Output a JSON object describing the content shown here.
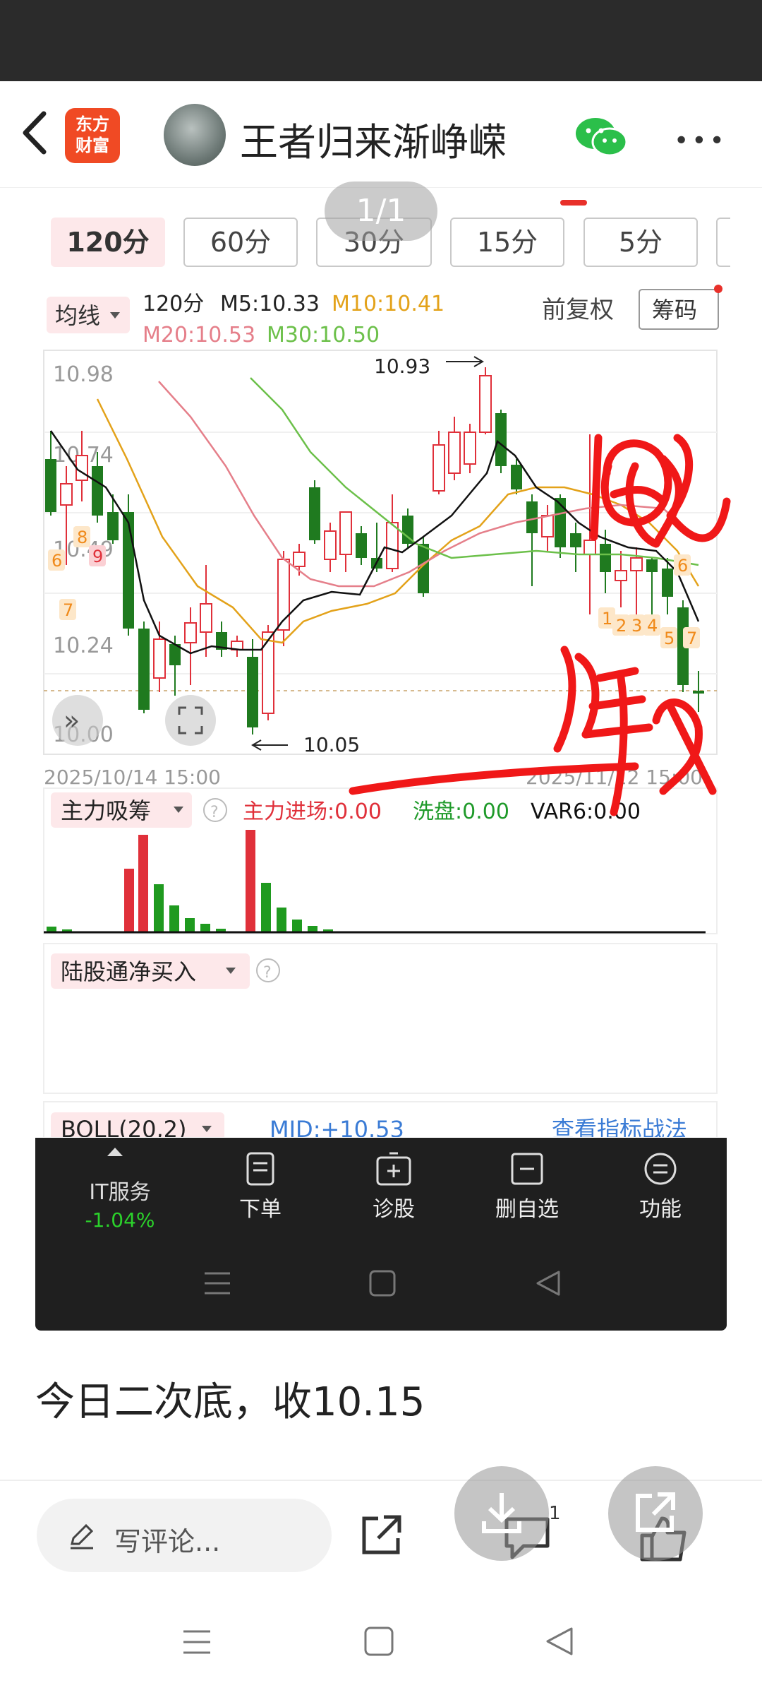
{
  "header": {
    "logo_line1": "东方",
    "logo_line2": "财富",
    "title": "王者归来渐峥嵘"
  },
  "image_pager": "1/1",
  "timeframes": [
    "120分",
    "60分",
    "30分",
    "15分",
    "5分"
  ],
  "chart": {
    "ma_dropdown": "均线",
    "period": "120分",
    "m5": "M5:10.33",
    "m10": "M10:10.41",
    "m20": "M20:10.53",
    "m30": "M30:10.50",
    "adjust": "前复权",
    "chips_button": "筹码",
    "y_labels": [
      "10.98",
      "10.74",
      "10.49",
      "10.24",
      "10.00"
    ],
    "high_label": "10.93",
    "low_label": "10.05",
    "date_start": "2025/10/14 15:00",
    "date_end": "2025/11/12 15:00",
    "td_numbers": [
      "6",
      "7",
      "8",
      "9",
      "1",
      "2",
      "3",
      "4",
      "5",
      "7",
      "6"
    ],
    "colors": {
      "up": "#e0303a",
      "down": "#1f7a1f",
      "m5": "#000000",
      "m10": "#e3a21a",
      "m20": "#e57f8a",
      "m30": "#6cc04a"
    }
  },
  "indicator1": {
    "name": "主力吸筹",
    "main_in": "主力进场:0.00",
    "wash": "洗盘:0.00",
    "var6": "VAR6:0.00"
  },
  "indicator2": {
    "name": "陆股通净买入"
  },
  "indicator3": {
    "name": "BOLL(20,2)",
    "mid": "MID:+10.53",
    "link": "查看指标战法"
  },
  "dock": {
    "stock_name": "IT服务",
    "stock_change": "-1.04%",
    "order": "下单",
    "diagnose": "诊股",
    "remove_watch": "删自选",
    "functions": "功能"
  },
  "post_text": "今日二次底，收10.15",
  "comment_placeholder": "写评论...",
  "comment_count": "1"
}
